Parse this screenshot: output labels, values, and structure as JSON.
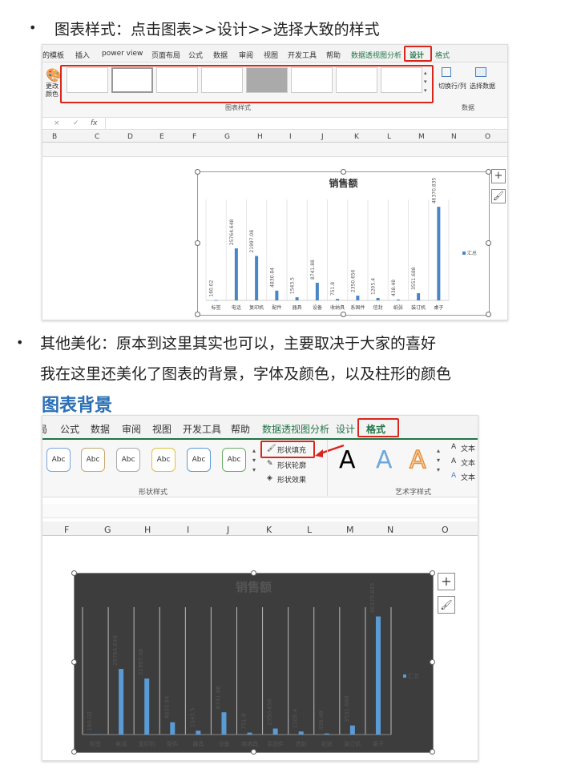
{
  "section1": {
    "bullet": "•",
    "text": "图表样式：点击图表>>设计>>选择大致的样式"
  },
  "shot1": {
    "tabs": [
      "的模板",
      "插入",
      "power view",
      "页面布局",
      "公式",
      "数据",
      "审阅",
      "视图",
      "开发工具",
      "帮助",
      "数据透视图分析",
      "设计",
      "格式"
    ],
    "active_tab": "设计",
    "left_button": "更改颜色",
    "style_group_label": "图表样式",
    "switch_row_col": "切换行/列",
    "select_data": "选择数据",
    "data_group_label": "数据",
    "formula_icons": [
      "×",
      "✓",
      "fx"
    ],
    "columns": [
      "B",
      "C",
      "D",
      "E",
      "F",
      "G",
      "H",
      "I",
      "J",
      "K",
      "L",
      "M",
      "N",
      "O"
    ],
    "side_buttons": [
      "+",
      "brush"
    ]
  },
  "section2": {
    "bullet": "•",
    "line1": "其他美化：原本到这里其实也可以，主要取决于大家的喜好",
    "line2": "我在这里还美化了图表的背景，字体及颜色，以及柱形的颜色",
    "heading": "图表背景"
  },
  "shot2": {
    "tabs": [
      "局",
      "公式",
      "数据",
      "审阅",
      "视图",
      "开发工具",
      "帮助",
      "数据透视图分析",
      "设计",
      "格式"
    ],
    "active_tab": "格式",
    "abc_label": "Abc",
    "shape_fill": "形状填充",
    "shape_outline": "形状轮廓",
    "shape_effect": "形状效果",
    "shape_style_label": "形状样式",
    "art_style_label": "艺术字样式",
    "art_letter": "A",
    "text_opts": [
      "文本",
      "文本",
      "文本"
    ],
    "columns": [
      "F",
      "G",
      "H",
      "I",
      "J",
      "K",
      "L",
      "M",
      "N",
      "O"
    ]
  },
  "chart_data": [
    {
      "type": "bar",
      "title": "销售额",
      "categories": [
        "标签",
        "电话",
        "复印机",
        "配件",
        "器具",
        "设备",
        "收纳具",
        "系固件",
        "信封",
        "纸张",
        "装订机",
        "桌子"
      ],
      "series": [
        {
          "name": "汇总",
          "values": [
            160.02,
            25764.648,
            21997.08,
            4830.84,
            1543.5,
            8741.88,
            751.8,
            2350.656,
            1205.4,
            438.48,
            3551.688,
            46370.835
          ]
        }
      ],
      "data_labels": [
        "160.02",
        "25764.648",
        "21997.08",
        "4830.84",
        "1543.5",
        "8741.88",
        "751.8",
        "2350.656",
        "1205.4",
        "438.48",
        "3551.688",
        "46370.835"
      ],
      "legend": "right",
      "ylim": [
        0,
        50000
      ],
      "style": "light"
    },
    {
      "type": "bar",
      "title": "销售额",
      "categories": [
        "标签",
        "电话",
        "复印机",
        "配件",
        "器具",
        "设备",
        "收纳具",
        "系固件",
        "信封",
        "纸张",
        "装订机",
        "桌子"
      ],
      "series": [
        {
          "name": "汇总",
          "values": [
            160.02,
            25764.648,
            21997.08,
            4830.84,
            1543.5,
            8741.88,
            751.8,
            2350.656,
            1205.4,
            438.48,
            3551.688,
            46370.835
          ]
        }
      ],
      "data_labels": [
        "160.02",
        "25764.648",
        "21997.08",
        "4830.84",
        "1543.5",
        "8741.88",
        "751.8",
        "2350.656",
        "1205.4",
        "438.48",
        "3551.688",
        "46370.835"
      ],
      "legend": "right",
      "ylim": [
        0,
        50000
      ],
      "style": "dark"
    }
  ],
  "colors": {
    "bar": "#4a86c5",
    "bar_dark": "#5b9bd5",
    "accent_red": "#d9261c",
    "excel_green": "#217346",
    "dark_bg": "#3d3d3d",
    "heading_blue": "#2a6fb5"
  }
}
